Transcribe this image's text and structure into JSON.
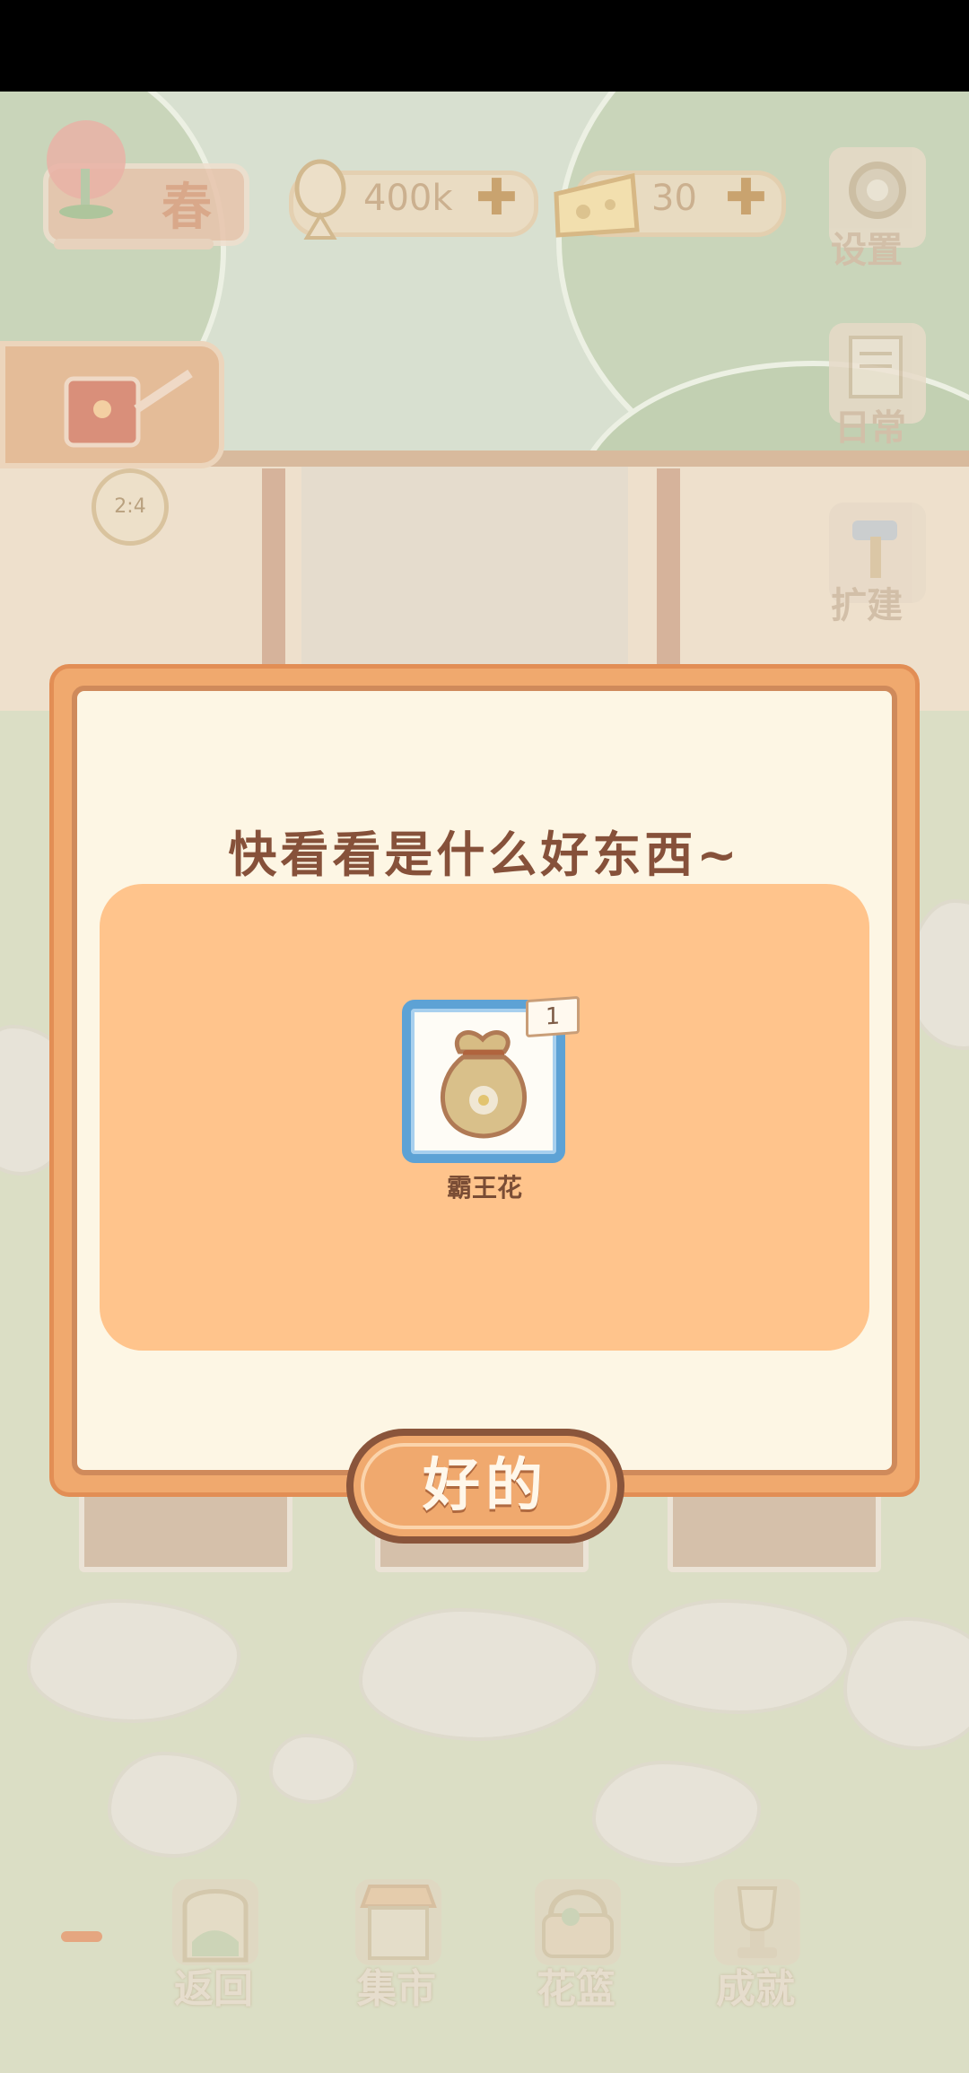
{
  "hud": {
    "season": "春",
    "fish_currency": "400k",
    "cheese_currency": "30",
    "plus_symbol": "✚",
    "timer": "2:4"
  },
  "side_menu": {
    "settings": "设置",
    "daily": "日常",
    "expand": "扩建"
  },
  "dialog": {
    "title": "快看看是什么好东西~",
    "reward": {
      "count": "1",
      "name": "霸王花",
      "icon": "seed-bag-icon"
    },
    "ok_label": "好的"
  },
  "bottom_nav": {
    "back": "返回",
    "market": "集市",
    "basket": "花篮",
    "achievements": "成就"
  },
  "colors": {
    "dialog_frame": "#f0a96e",
    "dialog_inner": "#fdf6e4",
    "reward_panel": "#ffc48c",
    "slot_border": "#5da2d5",
    "title_text": "#86513a"
  }
}
